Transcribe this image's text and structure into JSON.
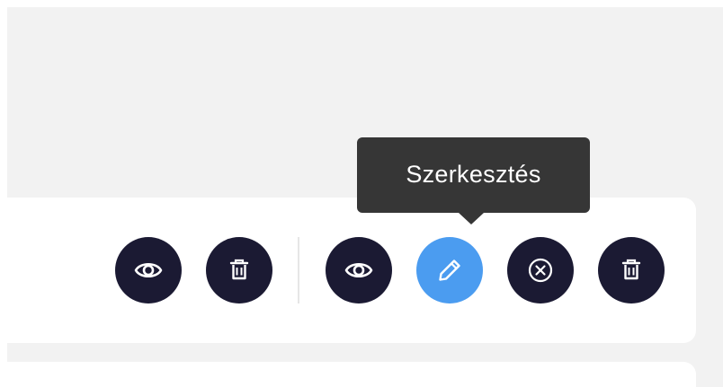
{
  "tooltip": {
    "text": "Szerkesztés"
  },
  "left_group": {
    "buttons": [
      {
        "icon": "eye-icon",
        "action": "view"
      },
      {
        "icon": "trash-icon",
        "action": "delete"
      }
    ]
  },
  "right_group": {
    "buttons": [
      {
        "icon": "eye-icon",
        "action": "view"
      },
      {
        "icon": "pencil-icon",
        "action": "edit",
        "state": "hovered"
      },
      {
        "icon": "circle-x-icon",
        "action": "cancel"
      },
      {
        "icon": "trash-icon",
        "action": "delete"
      }
    ]
  },
  "colors": {
    "page_background": "#f2f2f2",
    "card_background": "#ffffff",
    "button_dark": "#1b1a33",
    "button_active": "#4b9cf0",
    "tooltip_background": "#363636",
    "tooltip_text": "#ffffff"
  }
}
